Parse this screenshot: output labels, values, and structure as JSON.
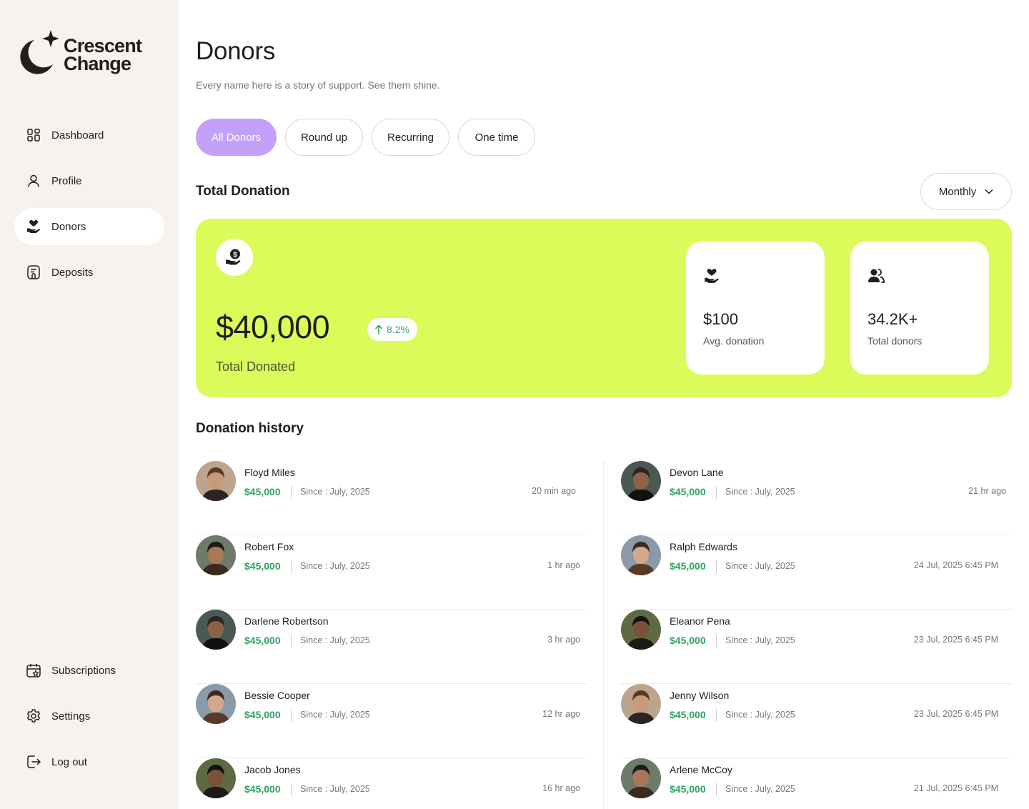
{
  "brand": {
    "line1": "Crescent",
    "line2": "Change",
    "accent": "#c4a1f8",
    "highlight": "#dcfa5a",
    "positive": "#2fa35f"
  },
  "sidebar": {
    "items": [
      {
        "label": "Dashboard",
        "icon": "dashboard-grid-icon"
      },
      {
        "label": "Profile",
        "icon": "user-icon"
      },
      {
        "label": "Donors",
        "icon": "heart-hand-icon",
        "active": true
      },
      {
        "label": "Deposits",
        "icon": "receipt-icon"
      }
    ],
    "bottom_items": [
      {
        "label": "Subscriptions",
        "icon": "calendar-star-icon"
      },
      {
        "label": "Settings",
        "icon": "gear-icon"
      },
      {
        "label": "Log out",
        "icon": "logout-icon"
      }
    ]
  },
  "header": {
    "title": "Donors",
    "subtitle": "Every name here is a story of support. See them shine."
  },
  "filters": [
    "All Donors",
    "Round up",
    "Recurring",
    "One time"
  ],
  "total_donation": {
    "section_title": "Total Donation",
    "period": "Monthly",
    "amount": "$40,000",
    "change": "8.2%",
    "label": "Total Donated",
    "stats": [
      {
        "value": "$100",
        "label": "Avg. donation",
        "icon": "heart-hand-icon"
      },
      {
        "value": "34.2K+",
        "label": "Total donors",
        "icon": "users-icon"
      }
    ]
  },
  "history": {
    "title": "Donation history",
    "since_prefix": "Since : ",
    "left": [
      {
        "name": "Floyd Miles",
        "amount": "$45,000",
        "since": "Since : July, 2025",
        "time": "20 min ago"
      },
      {
        "name": "Robert Fox",
        "amount": "$45,000",
        "since": "Since : July, 2025",
        "time": "1 hr ago"
      },
      {
        "name": "Darlene Robertson",
        "amount": "$45,000",
        "since": "Since : July, 2025",
        "time": "3 hr ago"
      },
      {
        "name": "Bessie Cooper",
        "amount": "$45,000",
        "since": "Since : July, 2025",
        "time": "12 hr ago"
      },
      {
        "name": "Jacob Jones",
        "amount": "$45,000",
        "since": "Since : July, 2025",
        "time": "16 hr ago"
      }
    ],
    "right": [
      {
        "name": "Devon Lane",
        "amount": "$45,000",
        "since": "Since : July, 2025",
        "time": "21 hr ago"
      },
      {
        "name": "Ralph Edwards",
        "amount": "$45,000",
        "since": "Since : July, 2025",
        "time": "24 Jul, 2025 6:45 PM"
      },
      {
        "name": "Eleanor Pena",
        "amount": "$45,000",
        "since": "Since : July, 2025",
        "time": "23 Jul, 2025 6:45 PM"
      },
      {
        "name": "Jenny Wilson",
        "amount": "$45,000",
        "since": "Since : July, 2025",
        "time": "23 Jul, 2025 6:45 PM"
      },
      {
        "name": "Arlene McCoy",
        "amount": "$45,000",
        "since": "Since : July, 2025",
        "time": "21 Jul, 2025 6:45 PM"
      }
    ]
  }
}
